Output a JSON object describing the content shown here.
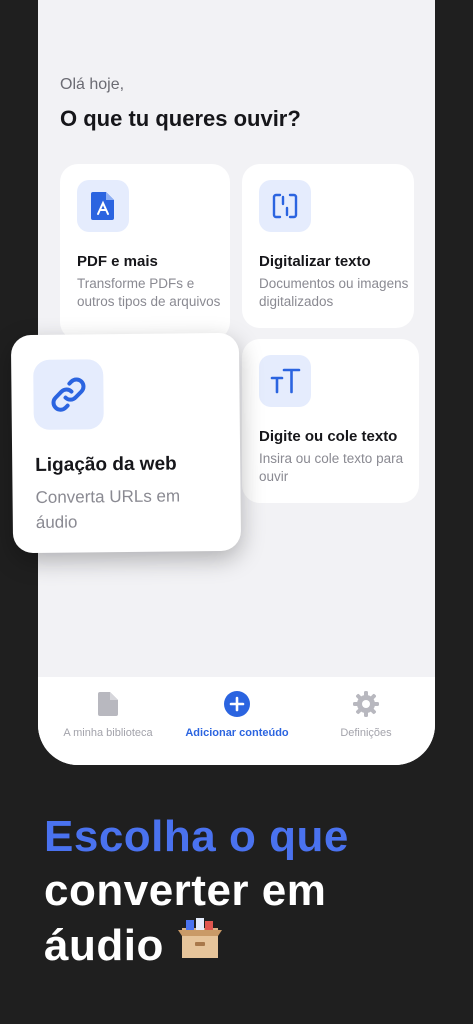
{
  "greeting": "Olá hoje,",
  "question": "O que tu queres ouvir?",
  "cards": {
    "pdf": {
      "title": "PDF e mais",
      "desc": "Transforme PDFs e outros tipos de arquivos",
      "icon": "pdf-file-icon"
    },
    "scan": {
      "title": "Digitalizar texto",
      "desc": "Documentos ou imagens digitalizados",
      "icon": "scan-text-icon"
    },
    "web": {
      "title": "Ligação da web",
      "desc": "Converta URLs em áudio",
      "icon": "link-icon"
    },
    "type": {
      "title": "Digite ou cole texto",
      "desc": "Insira ou cole texto para ouvir",
      "icon": "text-size-icon"
    }
  },
  "tabs": {
    "library": {
      "label": "A minha biblioteca",
      "icon": "document-icon"
    },
    "add": {
      "label": "Adicionar conteúdo",
      "icon": "plus-circle-icon"
    },
    "settings": {
      "label": "Definições",
      "icon": "gear-icon"
    }
  },
  "headline": {
    "line1": "Escolha o que",
    "line2": "converter em",
    "line3": "áudio",
    "emoji": "card-file-box-icon"
  },
  "colors": {
    "accent": "#2b64e0",
    "headline_accent": "#4a72ef",
    "icon_tile": "#e5ecfd",
    "background_dark": "#1f1f1f",
    "panel": "#f2f2f5"
  }
}
